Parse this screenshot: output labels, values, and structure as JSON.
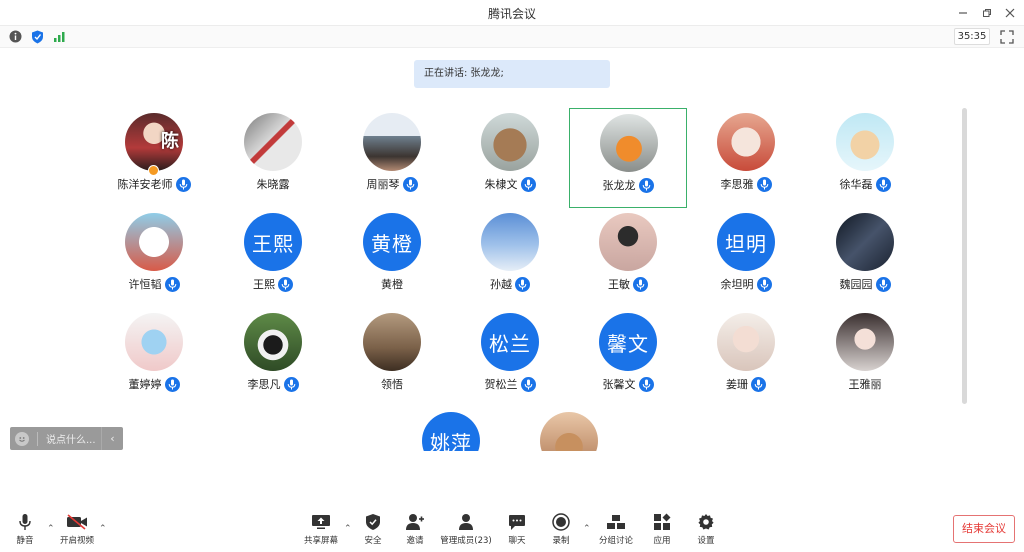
{
  "window": {
    "title": "腾讯会议",
    "timer": "35:35"
  },
  "speaking": {
    "label": "正在讲话: 张龙龙;"
  },
  "participants": [
    {
      "name": "陈洋安老师",
      "avatar_text": "陈",
      "mic": true
    },
    {
      "name": "朱晓露",
      "avatar_text": "",
      "mic": false
    },
    {
      "name": "周丽琴",
      "avatar_text": "",
      "mic": true
    },
    {
      "name": "朱棣文",
      "avatar_text": "",
      "mic": true
    },
    {
      "name": "张龙龙",
      "avatar_text": "",
      "mic": true
    },
    {
      "name": "李思雅",
      "avatar_text": "",
      "mic": true
    },
    {
      "name": "徐华磊",
      "avatar_text": "",
      "mic": true
    },
    {
      "name": "许恒韬",
      "avatar_text": "",
      "mic": true
    },
    {
      "name": "王熙",
      "avatar_text": "王熙",
      "mic": true
    },
    {
      "name": "黄橙",
      "avatar_text": "黄橙",
      "mic": false
    },
    {
      "name": "孙越",
      "avatar_text": "",
      "mic": true
    },
    {
      "name": "王敏",
      "avatar_text": "",
      "mic": true
    },
    {
      "name": "余坦明",
      "avatar_text": "坦明",
      "mic": true
    },
    {
      "name": "魏园园",
      "avatar_text": "",
      "mic": true
    },
    {
      "name": "董婷婷",
      "avatar_text": "",
      "mic": true
    },
    {
      "name": "李思凡",
      "avatar_text": "",
      "mic": true
    },
    {
      "name": "领悟",
      "avatar_text": "",
      "mic": false
    },
    {
      "name": "贺松兰",
      "avatar_text": "松兰",
      "mic": true
    },
    {
      "name": "张馨文",
      "avatar_text": "馨文",
      "mic": true
    },
    {
      "name": "姜珊",
      "avatar_text": "",
      "mic": true
    },
    {
      "name": "王雅丽",
      "avatar_text": "",
      "mic": false
    },
    {
      "name": "",
      "avatar_text": "姚萍",
      "mic": false
    },
    {
      "name": "",
      "avatar_text": "",
      "mic": false
    }
  ],
  "chat": {
    "placeholder": "说点什么..."
  },
  "toolbar": {
    "mute": "静音",
    "video": "开启视频",
    "share": "共享屏幕",
    "security": "安全",
    "invite": "邀请",
    "members": "管理成员(23)",
    "chat": "聊天",
    "record": "录制",
    "breakout": "分组讨论",
    "apps": "应用",
    "settings": "设置",
    "end": "结束会议"
  },
  "colors": {
    "accent": "#1a73e8",
    "active_border": "#3ab06a",
    "end": "#e53935"
  }
}
